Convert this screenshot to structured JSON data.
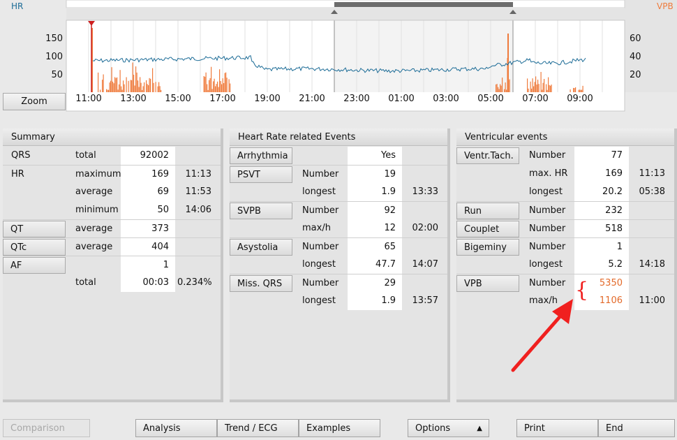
{
  "chart": {
    "hr_label": "HR",
    "vpb_label": "VPB",
    "left_ticks": [
      "150",
      "100",
      "50"
    ],
    "right_ticks": [
      "60",
      "40",
      "20"
    ],
    "time_ticks": [
      "11:00",
      "13:00",
      "15:00",
      "17:00",
      "19:00",
      "21:00",
      "23:00",
      "01:00",
      "03:00",
      "05:00",
      "07:00",
      "09:00"
    ],
    "zoom_label": "Zoom",
    "hr_color": "#1b6b96",
    "vpb_color": "#ef7b3c"
  },
  "summary": {
    "title": "Summary",
    "qrs": {
      "label": "QRS",
      "sub": "total",
      "value": "92002"
    },
    "hr": {
      "label": "HR",
      "rows": [
        {
          "sub": "maximum",
          "value": "169",
          "time": "11:13"
        },
        {
          "sub": "average",
          "value": "69",
          "time": "11:53"
        },
        {
          "sub": "minimum",
          "value": "50",
          "time": "14:06"
        }
      ]
    },
    "qt": {
      "label": "QT",
      "sub": "average",
      "value": "373"
    },
    "qtc": {
      "label": "QTc",
      "sub": "average",
      "value": "404"
    },
    "af": {
      "label": "AF",
      "value": "1",
      "sub2": "total",
      "value2": "00:03",
      "pct": "0.234%"
    }
  },
  "hr_events": {
    "title": "Heart Rate related Events",
    "arrhythmia": {
      "label": "Arrhythmia",
      "value": "Yes"
    },
    "psvt": {
      "label": "PSVT",
      "sub1": "Number",
      "val1": "19",
      "sub2": "longest",
      "val2": "1.9",
      "time2": "13:33"
    },
    "svpb": {
      "label": "SVPB",
      "sub1": "Number",
      "val1": "92",
      "sub2": "max/h",
      "val2": "12",
      "time2": "02:00"
    },
    "asystolia": {
      "label": "Asystolia",
      "sub1": "Number",
      "val1": "65",
      "sub2": "longest",
      "val2": "47.7",
      "time2": "14:07"
    },
    "missqrs": {
      "label": "Miss. QRS",
      "sub1": "Number",
      "val1": "29",
      "sub2": "longest",
      "val2": "1.9",
      "time2": "13:57"
    }
  },
  "ventricular": {
    "title": "Ventricular events",
    "vtach": {
      "label": "Ventr.Tach.",
      "sub1": "Number",
      "val1": "77",
      "sub2": "max. HR",
      "val2": "169",
      "time2": "11:13",
      "sub3": "longest",
      "val3": "20.2",
      "time3": "05:38"
    },
    "run": {
      "label": "Run",
      "sub": "Number",
      "value": "232"
    },
    "couplet": {
      "label": "Couplet",
      "sub": "Number",
      "value": "518"
    },
    "bigeminy": {
      "label": "Bigeminy",
      "sub1": "Number",
      "val1": "1",
      "sub2": "longest",
      "val2": "5.2",
      "time2": "14:18"
    },
    "vpb": {
      "label": "VPB",
      "sub1": "Number",
      "val1": "5350",
      "sub2": "max/h",
      "val2": "1106",
      "time2": "11:00"
    }
  },
  "bottom": {
    "comparison": "Comparison",
    "analysis": "Analysis",
    "trend": "Trend / ECG",
    "examples": "Examples",
    "options": "Options",
    "print": "Print",
    "end": "End"
  },
  "annotation": {
    "arrow_color": "#f0201f",
    "brace": "{"
  }
}
